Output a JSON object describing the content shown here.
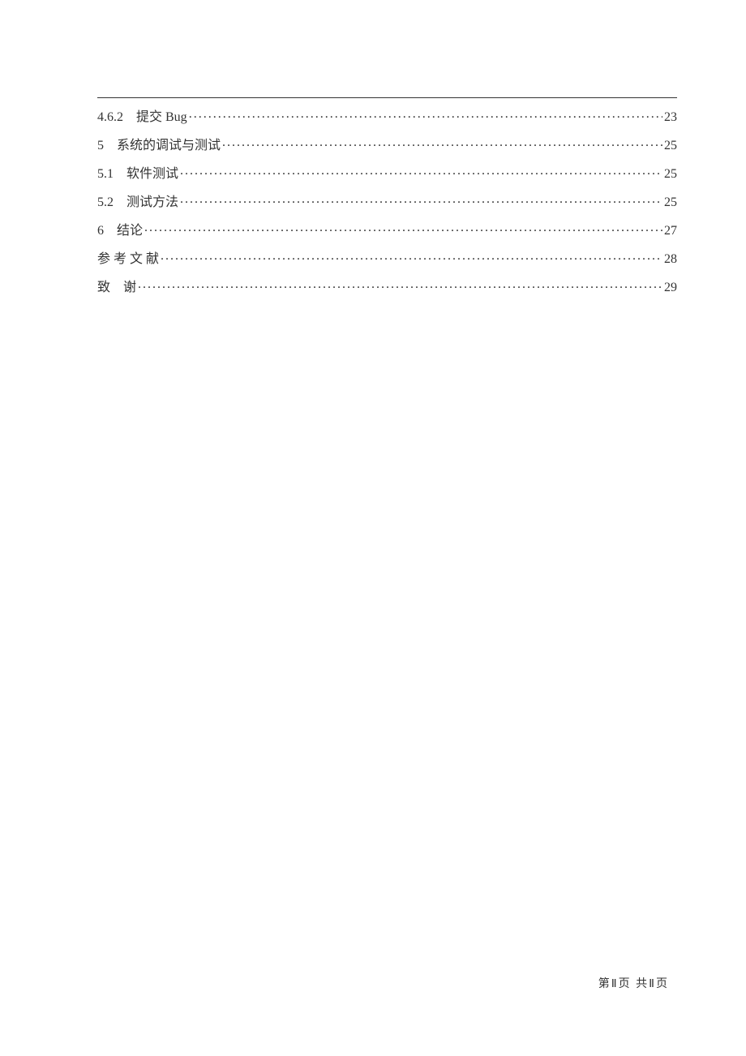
{
  "toc": {
    "entries": [
      {
        "label": "4.6.2　提交 Bug",
        "page": "23"
      },
      {
        "label": "5　系统的调试与测试",
        "page": "25"
      },
      {
        "label": "5.1　软件测试",
        "page": "25"
      },
      {
        "label": "5.2　测试方法",
        "page": "25"
      },
      {
        "label": "6　结论",
        "page": "27"
      },
      {
        "label": "参 考 文 献",
        "page": "28"
      },
      {
        "label": "致　谢",
        "page": "29"
      }
    ]
  },
  "footer": {
    "text": "第Ⅱ页 共Ⅱ页"
  }
}
